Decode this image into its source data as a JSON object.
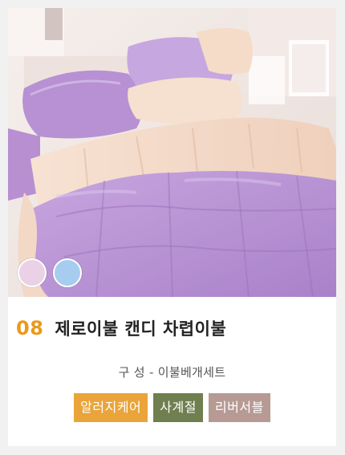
{
  "product": {
    "number": "08",
    "name": "제로이불 캔디 차렵이불",
    "composition": "구 성 - 이불베개세트",
    "color_options": [
      {
        "name": "lavender-pink",
        "color": "#ead1e6"
      },
      {
        "name": "light-blue",
        "color": "#a6cdf0"
      }
    ],
    "tags": [
      {
        "label": "알러지케어",
        "color": "#e9a43a"
      },
      {
        "label": "사계절",
        "color": "#6f7f4f"
      },
      {
        "label": "리버서블",
        "color": "#b79a94"
      }
    ]
  }
}
